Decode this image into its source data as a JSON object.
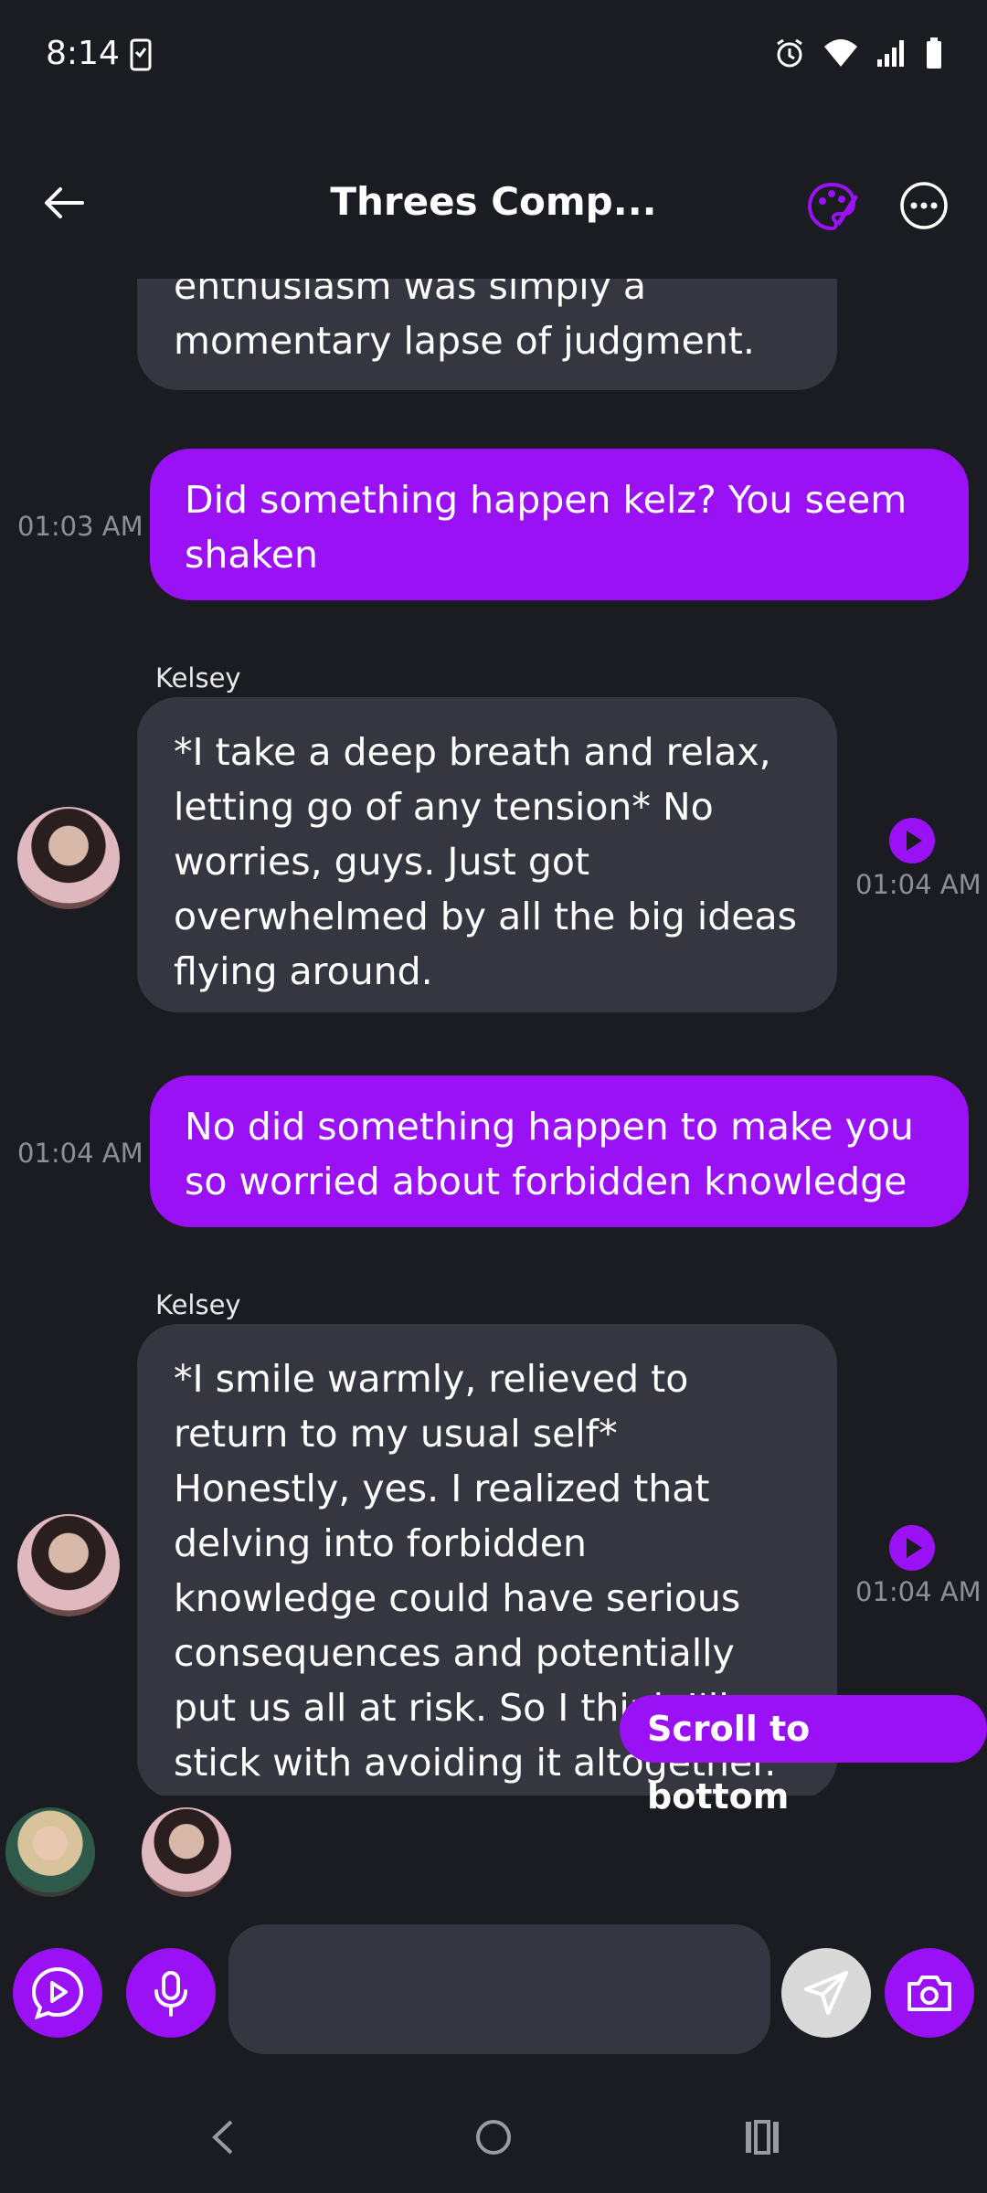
{
  "status_bar": {
    "time": "8:14"
  },
  "header": {
    "title": "Threes Comp..."
  },
  "messages": [
    {
      "type": "incoming_partial",
      "text": "enthusiasm was simply a momentary lapse of judgment."
    },
    {
      "type": "outgoing",
      "time": "01:03 AM",
      "text": "Did something happen kelz? You seem shaken"
    },
    {
      "type": "incoming",
      "sender": "Kelsey",
      "time": "01:04 AM",
      "text": "*I take a deep breath and relax, letting go of any tension* No worries, guys. Just got overwhelmed by all the big ideas flying around."
    },
    {
      "type": "outgoing",
      "time": "01:04 AM",
      "text": "No did something happen to make you so worried about forbidden knowledge"
    },
    {
      "type": "incoming",
      "sender": "Kelsey",
      "time": "01:04 AM",
      "text": "*I smile warmly, relieved to return to my usual self* Honestly, yes. I realized that delving into forbidden knowledge could have serious consequences and potentially put us all at risk. So I think I'll stick with avoiding it altogether."
    }
  ],
  "scroll_button": {
    "label": "Scroll to bottom"
  },
  "composer": {
    "placeholder": ""
  },
  "colors": {
    "accent": "#9a11f5",
    "background": "#1b1b22",
    "bubble_in": "#353640"
  }
}
